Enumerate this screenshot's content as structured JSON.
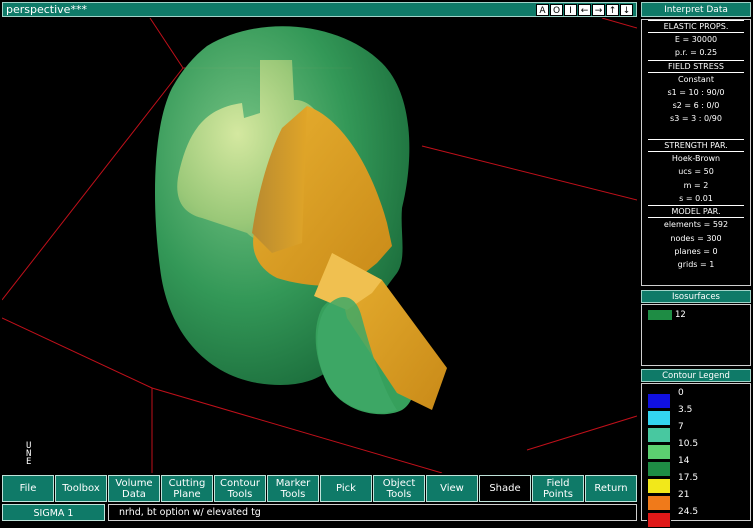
{
  "window": {
    "title": "perspective***",
    "buttons": [
      "A",
      "O",
      "I",
      "←",
      "→",
      "↑",
      "↓"
    ]
  },
  "panel": {
    "header": "Interpret Data",
    "lines": [
      {
        "text": "ELASTIC PROPS.",
        "head": true
      },
      {
        "text": "E = 30000"
      },
      {
        "text": "p.r. = 0.25"
      },
      {
        "text": "FIELD STRESS",
        "head": true
      },
      {
        "text": "Constant"
      },
      {
        "text": "s1 = 10 : 90/0"
      },
      {
        "text": "s2 = 6 : 0/0"
      },
      {
        "text": "s3 = 3 : 0/90"
      },
      {
        "text": ""
      },
      {
        "text": "STRENGTH PAR.",
        "head": true
      },
      {
        "text": "Hoek-Brown"
      },
      {
        "text": "ucs = 50"
      },
      {
        "text": "m = 2"
      },
      {
        "text": "s = 0.01"
      },
      {
        "text": "MODEL PAR.",
        "head": true
      },
      {
        "text": "elements = 592"
      },
      {
        "text": "nodes = 300"
      },
      {
        "text": "planes = 0"
      },
      {
        "text": "grids = 1"
      }
    ]
  },
  "isosurfaces": {
    "header": "Isosurfaces",
    "items": [
      {
        "label": "12",
        "color": "#1e8c44"
      }
    ]
  },
  "legend": {
    "header": "Contour Legend",
    "items": [
      {
        "label": "0",
        "color": "#1010e0"
      },
      {
        "label": "3.5",
        "color": "#33d4f0"
      },
      {
        "label": "7",
        "color": "#48c8a0"
      },
      {
        "label": "10.5",
        "color": "#5cd070"
      },
      {
        "label": "14",
        "color": "#1e8c44"
      },
      {
        "label": "17.5",
        "color": "#f2e81a"
      },
      {
        "label": "21",
        "color": "#f07a1a"
      },
      {
        "label": "24.5",
        "color": "#e01818"
      }
    ]
  },
  "axis_labels": [
    "U",
    "N",
    "E"
  ],
  "toolbar": [
    {
      "label": "File",
      "name": "file"
    },
    {
      "label": "Toolbox",
      "name": "toolbox"
    },
    {
      "label": "Volume\nData",
      "name": "volume-data"
    },
    {
      "label": "Cutting\nPlane",
      "name": "cutting-plane"
    },
    {
      "label": "Contour\nTools",
      "name": "contour-tools"
    },
    {
      "label": "Marker\nTools",
      "name": "marker-tools"
    },
    {
      "label": "Pick",
      "name": "pick"
    },
    {
      "label": "Object\nTools",
      "name": "object-tools"
    },
    {
      "label": "View",
      "name": "view"
    },
    {
      "label": "Shade",
      "name": "shade",
      "active": true
    },
    {
      "label": "Field\nPoints",
      "name": "field-points"
    },
    {
      "label": "Return",
      "name": "return"
    }
  ],
  "status": {
    "left": "SIGMA 1",
    "right": "nrhd, bt option w/ elevated tg"
  },
  "colors": {
    "accent": "#0f7a68",
    "grid_line": "#c0101a",
    "isosurface": "#2e9c5a",
    "excavation": "#e0a020"
  }
}
